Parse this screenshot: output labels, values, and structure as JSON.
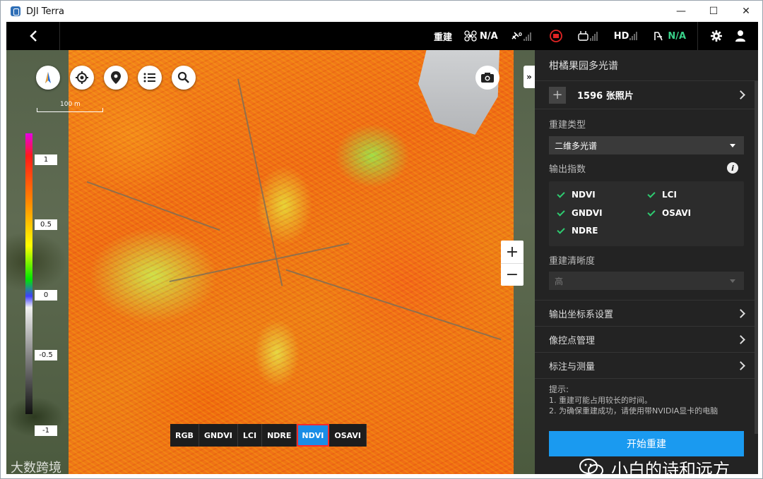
{
  "window": {
    "title": "DJI Terra",
    "min": "—",
    "max": "☐",
    "close": "✕"
  },
  "topbar": {
    "rebuild": "重建",
    "drone_status": "N/A",
    "hd_label": "HD",
    "rtk_status": "N/A"
  },
  "map": {
    "scale_label": "100 m",
    "legend": [
      "1",
      "0.5",
      "0",
      "-0.5",
      "-1"
    ],
    "index_tabs": [
      {
        "label": "RGB",
        "active": false
      },
      {
        "label": "GNDVI",
        "active": false
      },
      {
        "label": "LCI",
        "active": false
      },
      {
        "label": "NDRE",
        "active": false
      },
      {
        "label": "NDVI",
        "active": true
      },
      {
        "label": "OSAVI",
        "active": false
      }
    ],
    "zoom_in": "+",
    "zoom_out": "−",
    "collapse": "»",
    "watermark": "大数跨境"
  },
  "panel": {
    "title": "柑橘果园多光谱",
    "photo_count": "1596 张照片",
    "rebuild_type_label": "重建类型",
    "rebuild_type_value": "二维多光谱",
    "output_index_label": "输出指数",
    "indices": [
      "NDVI",
      "LCI",
      "GNDVI",
      "OSAVI",
      "NDRE"
    ],
    "resolution_label": "重建清晰度",
    "resolution_value": "高",
    "nav_rows": [
      "输出坐标系设置",
      "像控点管理",
      "标注与测量"
    ],
    "tips_title": "提示:",
    "tips": [
      "1. 重建可能占用较长的时间。",
      "2. 为确保重建成功，请使用带NVIDIA显卡的电脑"
    ],
    "start_button": "开始重建"
  },
  "overlay": {
    "watermark_text": "小白的诗和远方"
  },
  "colors": {
    "accent": "#1a9af0",
    "ok": "#2ecc71",
    "highlight": "#ff2a2a"
  }
}
